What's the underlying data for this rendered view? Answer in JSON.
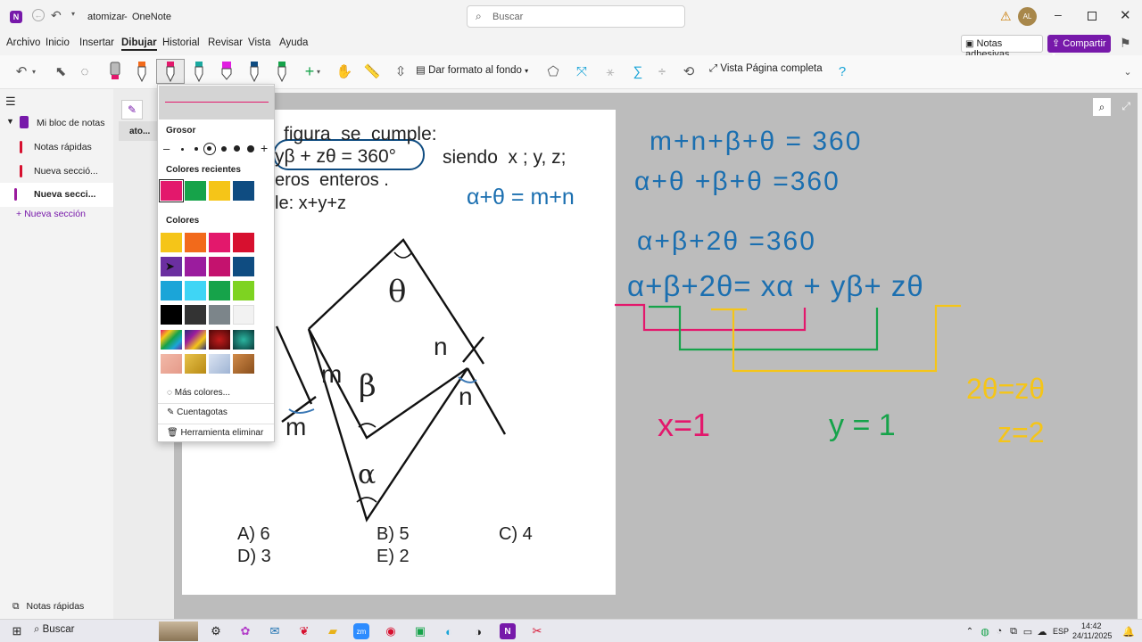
{
  "app": {
    "title": "atomizar",
    "separator": "-",
    "app_name": "OneNote",
    "search_placeholder": "Buscar",
    "user_initials": "AL"
  },
  "menu": [
    "Archivo",
    "Inicio",
    "Insertar",
    "Dibujar",
    "Historial",
    "Revisar",
    "Vista",
    "Ayuda"
  ],
  "right_buttons": {
    "sticky": "Notas adhesivas",
    "share": "Compartir"
  },
  "ribbon": {
    "format_bg": "Dar formato al fondo",
    "full_page": "Vista Página completa"
  },
  "sidebar": {
    "notebook": "Mi bloc de notas",
    "sections": [
      "Notas rápidas",
      "Nueva secció...",
      "Nueva secci..."
    ],
    "add_section": "Nueva sección",
    "footer": "Notas rápidas"
  },
  "pagelist": {
    "page": "ato..."
  },
  "picker": {
    "grosor": "Grosor",
    "recent": "Colores recientes",
    "colors": "Colores",
    "more": "Más colores...",
    "eyedropper": "Cuentagotas",
    "eraser": "Herramienta eliminar",
    "recent_colors": [
      "#e3186c",
      "#16a34a",
      "#f5c518",
      "#0f4c81"
    ],
    "palette": [
      "#f5c518",
      "#f26a1b",
      "#e3186c",
      "#d7102f",
      "#6b2fa0",
      "#9b1c9e",
      "#c4126e",
      "#0f4c81",
      "#1ba5d8",
      "#3fd5f5",
      "#16a34a",
      "#7ed321",
      "#000000",
      "#333333",
      "#7c858a",
      "#f2f2f2"
    ]
  },
  "paper": {
    "line1": "figura  se  cumple:",
    "box": "yβ + zθ = 360°",
    "siendo": "siendo  x ; y, z;",
    "line3": "eros  enteros .",
    "line4": "le: x+y+z",
    "labels": {
      "theta": "θ",
      "beta": "β",
      "alpha": "α",
      "m1": "m",
      "m2": "m",
      "n1": "n",
      "n2": "n"
    },
    "answers": [
      "A) 6",
      "B) 5",
      "C) 4",
      "D) 3",
      "E) 2"
    ]
  },
  "ink": {
    "eq1": "m+n+β+θ = 360",
    "eq2": "α+θ +β+θ =360",
    "eq3": "α+θ = m+n",
    "eq4": "α+β+2θ =360",
    "eq5": "α+β+2θ= xα + yβ+ zθ",
    "x": "x=1",
    "y": "y = 1",
    "z1": "2θ=zθ",
    "z2": "z=2"
  },
  "taskbar": {
    "search": "Buscar",
    "lang": "ESP",
    "time": "14:42",
    "date": "24/11/2025"
  }
}
